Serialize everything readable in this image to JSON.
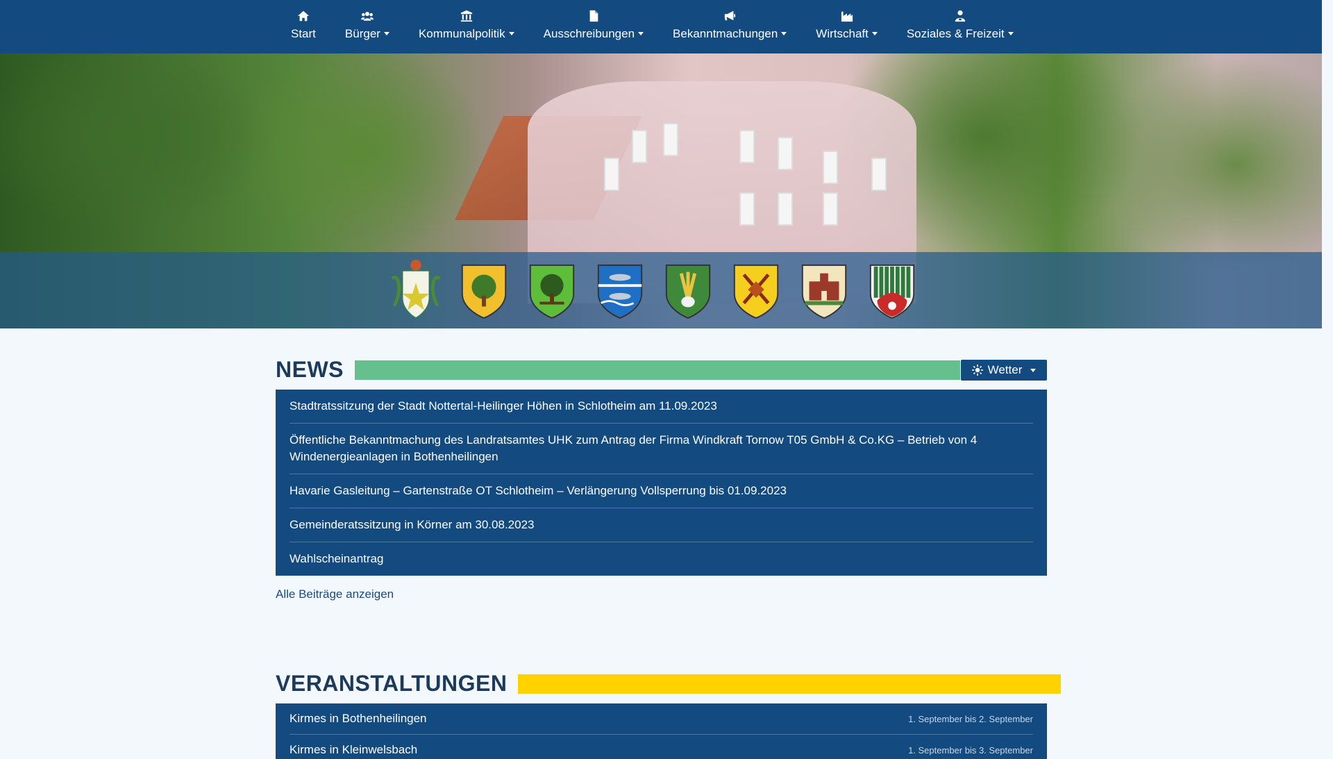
{
  "nav": {
    "items": [
      {
        "label": "Start",
        "icon": "home-icon",
        "dropdown": false
      },
      {
        "label": "Bürger",
        "icon": "users-icon",
        "dropdown": true
      },
      {
        "label": "Kommunalpolitik",
        "icon": "institution-icon",
        "dropdown": true
      },
      {
        "label": "Ausschreibungen",
        "icon": "document-icon",
        "dropdown": true
      },
      {
        "label": "Bekanntmachungen",
        "icon": "megaphone-icon",
        "dropdown": true
      },
      {
        "label": "Wirtschaft",
        "icon": "industry-icon",
        "dropdown": true
      },
      {
        "label": "Soziales & Freizeit",
        "icon": "person-icon",
        "dropdown": true
      }
    ]
  },
  "hero": {
    "crests": [
      "crest-notertal",
      "crest-oak-gold",
      "crest-tree-green",
      "crest-fish-blue",
      "crest-wheat-green",
      "crest-tools-gold",
      "crest-castle-cream",
      "crest-poplars-green"
    ]
  },
  "news": {
    "title": "NEWS",
    "accent_color": "#66c08e",
    "weather_label": "Wetter",
    "items": [
      "Stadtratssitzung der Stadt Nottertal-Heilinger Höhen in Schlotheim am 11.09.2023",
      "Öffentliche Bekanntmachung des Landratsamtes UHK zum Antrag der Firma Windkraft Tornow T05 GmbH & Co.KG – Betrieb von 4 Windener­gieanlagen in Bothenheilingen",
      "Havarie Gasleitung – Gartenstraße OT Schlotheim – Verlängerung Vollsperrung bis 01.09.2023",
      "Gemeinderatssitzung in Körner am 30.08.2023",
      "Wahlscheinantrag"
    ],
    "all_link": "Alle Beiträge anzeigen"
  },
  "events": {
    "title": "VERANSTALTUNGEN",
    "accent_color": "#ffd200",
    "items": [
      {
        "title": "Kirmes in Bothenheilingen",
        "date": "1. September bis 2. September"
      },
      {
        "title": "Kirmes in Kleinwelsbach",
        "date": "1. September bis 3. September"
      }
    ]
  },
  "colors": {
    "nav_bg": "#134a80",
    "page_bg": "#f2f8fc",
    "heading": "#1b3a5c"
  }
}
